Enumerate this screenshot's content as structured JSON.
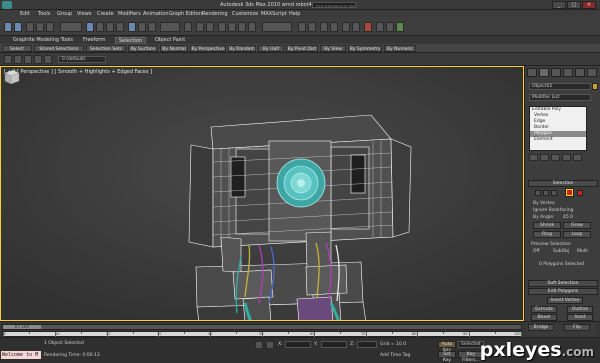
{
  "window": {
    "title": "Autodesk 3ds Max  2010     wmd robot4.max",
    "search_placeholder": "Type a keyword or phrase",
    "controls": [
      "_",
      "□",
      "×"
    ]
  },
  "menu": [
    "Edit",
    "Tools",
    "Group",
    "Views",
    "Create",
    "Modifiers",
    "Animation",
    "Graph Editors",
    "Rendering",
    "Customize",
    "MAXScript",
    "Help"
  ],
  "ribbon": {
    "tabs": [
      "Graphite Modeling Tools",
      "Freeform",
      "Selection",
      "Object Paint"
    ],
    "active_tab": "Selection",
    "buttons": [
      "Select",
      "Stored Selections",
      "Selection Sets",
      "By Surface",
      "By Normal",
      "By Perspective",
      "By Random",
      "By Half",
      "By Pivot Dist",
      "By View",
      "By Symmetry",
      "By Numeric"
    ]
  },
  "layer": {
    "value": "0 (default)"
  },
  "viewport": {
    "label": "[ + ] [ Perspective ] [ Smooth + Highlights + Edged Faces ]",
    "border_color": "#ffcc33"
  },
  "command_panel": {
    "object_name": "Object02",
    "object_color": "#c8a030",
    "modifier_list": "Modifier List",
    "stack": [
      "Editable Poly",
      "Vertex",
      "Edge",
      "Border",
      "Polygon",
      "Element"
    ],
    "stack_selected": "Polygon",
    "selection_rollout": "Selection",
    "by_vertex": "By Vertex",
    "ignore_backfacing": "Ignore Backfacing",
    "by_angle": "By Angle:",
    "angle_value": "45.0",
    "shrink": "Shrink",
    "grow": "Grow",
    "ring": "Ring",
    "loop": "Loop",
    "preview_selection": "Preview Selection",
    "preview_options": [
      "Off",
      "SubObj",
      "Multi"
    ],
    "selected_status": "0 Polygons Selected",
    "soft_selection": "Soft Selection",
    "edit_polygons": "Edit Polygons",
    "insert_vertex": "Insert Vertex",
    "ops": [
      "Extrude",
      "Outline",
      "Bevel",
      "Inset",
      "Bridge",
      "Flip"
    ]
  },
  "timeline": {
    "frame": "0 / 100",
    "ticks": [
      "0",
      "10",
      "20",
      "30",
      "40",
      "50",
      "60",
      "70",
      "80",
      "90",
      "100"
    ]
  },
  "status": {
    "maxscript": "Welcome to M",
    "selection": "1 Object Selected",
    "render_time": "Rendering Time: 0:00:13",
    "x": "X:",
    "y": "Y:",
    "z": "Z:",
    "grid": "Grid = 10.0",
    "add_time_tag": "Add Time Tag",
    "auto_key": "Auto Key",
    "selected": "Selected",
    "set_key": "Set Key",
    "key_filters": "Key Filters..."
  },
  "watermark": {
    "brand": "pxleyes",
    "tld": ".com"
  }
}
